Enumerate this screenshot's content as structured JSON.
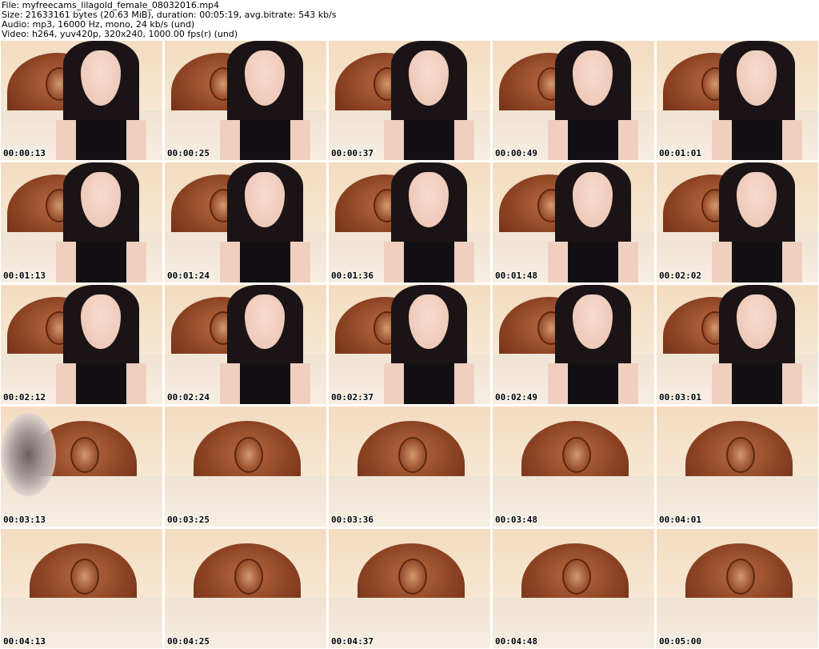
{
  "header": {
    "file": "File: myfreecams_lilagold_female_08032016.mp4",
    "size": "Size: 21633161 bytes (20.63 MiB), duration: 00:05:19, avg.bitrate: 543 kb/s",
    "audio": "Audio: mp3, 16000 Hz, mono, 24 kb/s (und)",
    "video": "Video: h264, yuv420p, 320x240, 1000.00 fps(r) (und)"
  },
  "thumbnails": [
    {
      "time": "00:00:13",
      "kind": "person"
    },
    {
      "time": "00:00:25",
      "kind": "person"
    },
    {
      "time": "00:00:37",
      "kind": "person"
    },
    {
      "time": "00:00:49",
      "kind": "person"
    },
    {
      "time": "00:01:01",
      "kind": "person"
    },
    {
      "time": "00:01:13",
      "kind": "person"
    },
    {
      "time": "00:01:24",
      "kind": "person"
    },
    {
      "time": "00:01:36",
      "kind": "person"
    },
    {
      "time": "00:01:48",
      "kind": "person"
    },
    {
      "time": "00:02:02",
      "kind": "person"
    },
    {
      "time": "00:02:12",
      "kind": "person"
    },
    {
      "time": "00:02:24",
      "kind": "person"
    },
    {
      "time": "00:02:37",
      "kind": "person"
    },
    {
      "time": "00:02:49",
      "kind": "person"
    },
    {
      "time": "00:03:01",
      "kind": "person"
    },
    {
      "time": "00:03:13",
      "kind": "blur"
    },
    {
      "time": "00:03:25",
      "kind": "empty"
    },
    {
      "time": "00:03:36",
      "kind": "empty"
    },
    {
      "time": "00:03:48",
      "kind": "empty"
    },
    {
      "time": "00:04:01",
      "kind": "empty"
    },
    {
      "time": "00:04:13",
      "kind": "empty"
    },
    {
      "time": "00:04:25",
      "kind": "empty"
    },
    {
      "time": "00:04:37",
      "kind": "empty"
    },
    {
      "time": "00:04:48",
      "kind": "empty"
    },
    {
      "time": "00:05:00",
      "kind": "empty"
    }
  ]
}
